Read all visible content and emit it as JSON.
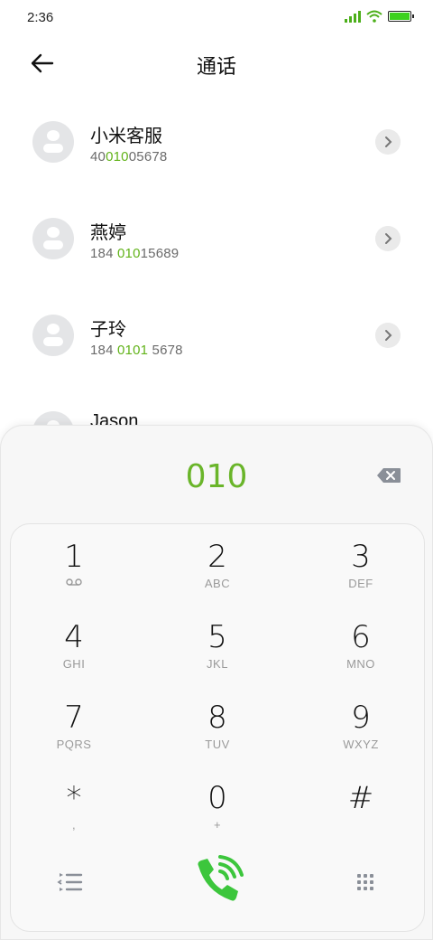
{
  "status": {
    "time": "2:36"
  },
  "header": {
    "title": "通话"
  },
  "contacts": [
    {
      "name": "小米客服",
      "num_pre": "40",
      "num_hl": "010",
      "num_post": "05678"
    },
    {
      "name": "燕婷",
      "num_pre": "184 ",
      "num_hl": "010",
      "num_post": "15689"
    },
    {
      "name": "子玲",
      "num_pre": "184 ",
      "num_hl": "0101",
      "num_post": " 5678"
    },
    {
      "name": "Jason"
    }
  ],
  "dialer": {
    "display": "010",
    "keys": [
      {
        "digit": "1",
        "letters": ""
      },
      {
        "digit": "2",
        "letters": "ABC"
      },
      {
        "digit": "3",
        "letters": "DEF"
      },
      {
        "digit": "4",
        "letters": "GHI"
      },
      {
        "digit": "5",
        "letters": "JKL"
      },
      {
        "digit": "6",
        "letters": "MNO"
      },
      {
        "digit": "7",
        "letters": "PQRS"
      },
      {
        "digit": "8",
        "letters": "TUV"
      },
      {
        "digit": "9",
        "letters": "WXYZ"
      },
      {
        "digit": "*",
        "letters": ","
      },
      {
        "digit": "0",
        "letters": "+"
      },
      {
        "digit": "#",
        "letters": ""
      }
    ]
  },
  "colors": {
    "accent": "#62b31a",
    "call_green": "#3cc63c"
  }
}
